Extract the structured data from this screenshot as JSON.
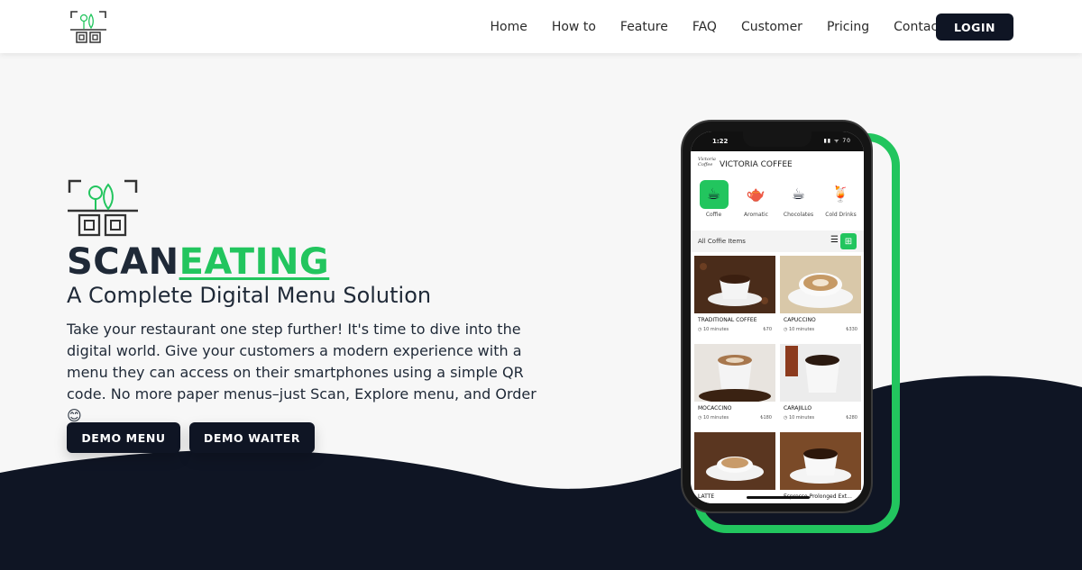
{
  "nav": {
    "logo_icon": "qr-leaf-logo-icon",
    "links": [
      "Home",
      "How to",
      "Feature",
      "FAQ",
      "Customer",
      "Pricing",
      "Contact"
    ],
    "login_label": "LOGIN"
  },
  "hero": {
    "logo_icon": "qr-leaf-logo-icon",
    "brand_part1": "SCAN",
    "brand_part2": "EATING",
    "subtitle": "A Complete Digital Menu Solution",
    "description": "Take your restaurant one step further! It's time to dive into the digital world. Give your customers a modern experience with a menu they can access on their smartphones using a simple QR code. No more paper menus–just Scan, Explore menu, and Order",
    "emoji": "😊",
    "btn_menu": "DEMO MENU",
    "btn_waiter": "DEMO WAITER"
  },
  "phone": {
    "time": "1:22",
    "status_icons": "▮▮ ᯤ 70",
    "cafe_logo_text": "Victoria Coffee",
    "cafe_name": "VICTORIA COFFEE",
    "categories": [
      {
        "label": "Coffie",
        "icon": "☕",
        "active": true
      },
      {
        "label": "Aromatic",
        "icon": "🫖",
        "active": false
      },
      {
        "label": "Chocolates",
        "icon": "☕",
        "active": false
      },
      {
        "label": "Cold Drinks",
        "icon": "🍹",
        "active": false
      }
    ],
    "list_title": "All Coffie Items",
    "items": [
      {
        "name": "TRADITIONAL COFFEE",
        "time": "◷ 10 minutes",
        "price": "₺70"
      },
      {
        "name": "CAPUCCINO",
        "time": "◷ 10 minutes",
        "price": "₺330"
      },
      {
        "name": "MOCACCINO",
        "time": "◷ 10 minutes",
        "price": "₺180"
      },
      {
        "name": "CARAJILLO",
        "time": "◷ 10 minutes",
        "price": "₺280"
      },
      {
        "name": "LATTE",
        "time": "",
        "price": ""
      },
      {
        "name": "Espresso Prolonged Ext...",
        "time": "",
        "price": ""
      }
    ]
  },
  "colors": {
    "accent_green": "#22c55e",
    "navy": "#0f1524"
  }
}
